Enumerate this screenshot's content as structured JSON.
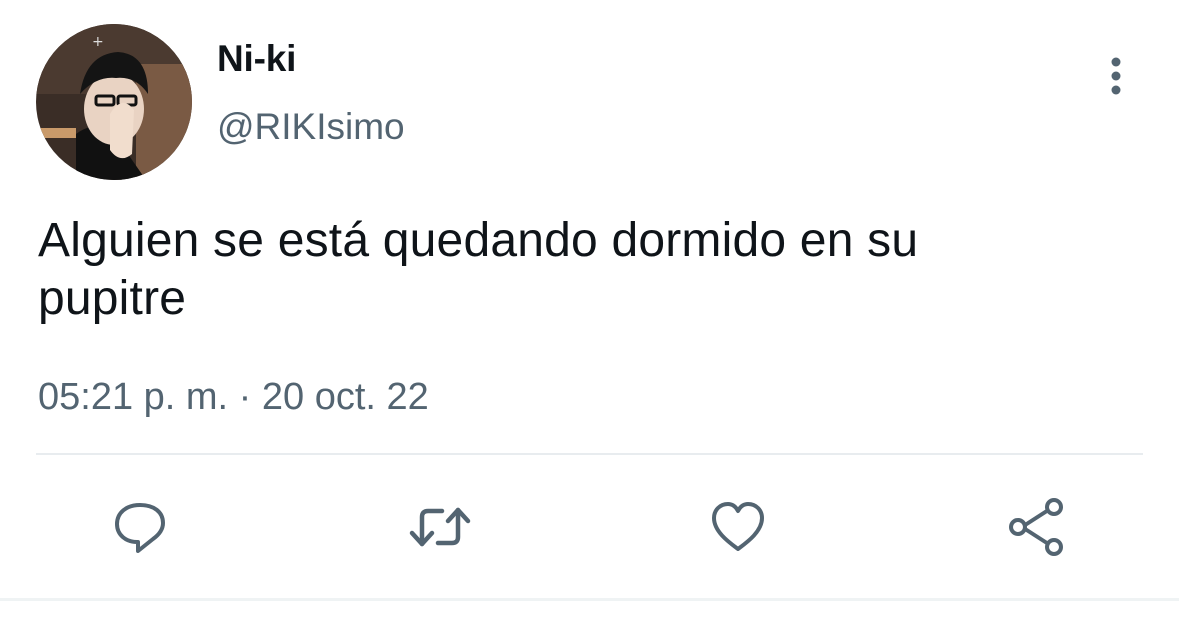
{
  "tweet": {
    "author": {
      "display_name": "Ni-ki",
      "handle": "@RIKIsimo",
      "avatar": "avatar"
    },
    "menu_icon": "more-vertical-icon",
    "text": "Alguien se está quedando dormido en su pupitre",
    "timestamp": "05:21 p. m. · 20 oct. 22",
    "actions": [
      {
        "name": "reply",
        "icon": "reply-icon"
      },
      {
        "name": "retweet",
        "icon": "retweet-icon"
      },
      {
        "name": "like",
        "icon": "heart-icon"
      },
      {
        "name": "share",
        "icon": "share-icon"
      }
    ]
  },
  "colors": {
    "primary_text": "#0f1419",
    "secondary_text": "#536471",
    "icon": "#536471",
    "divider": "#e8ecef",
    "background": "#ffffff"
  }
}
